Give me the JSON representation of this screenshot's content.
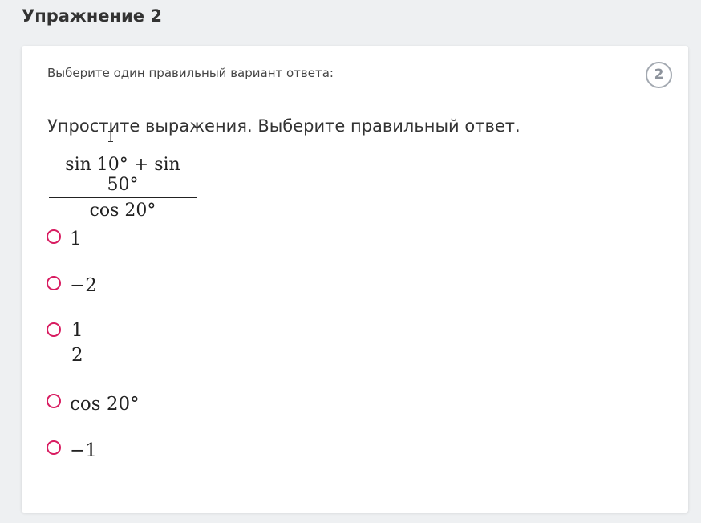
{
  "header": {
    "title": "Упражнение 2"
  },
  "card": {
    "instruction": "Выберите один правильный вариант ответа:",
    "badge": "2",
    "question": "Упростите выражения. Выберите правильный ответ.",
    "expression": {
      "numerator": "sin 10° + sin 50°",
      "denominator": "cos 20°"
    },
    "options": [
      {
        "label": "1"
      },
      {
        "label": "−2"
      },
      {
        "numerator": "1",
        "denominator": "2"
      },
      {
        "label": "cos 20°"
      },
      {
        "label": "−1"
      }
    ]
  },
  "colors": {
    "radio_accent": "#d81b60",
    "badge_border": "#a3a9b1",
    "page_background": "#eef0f2"
  }
}
